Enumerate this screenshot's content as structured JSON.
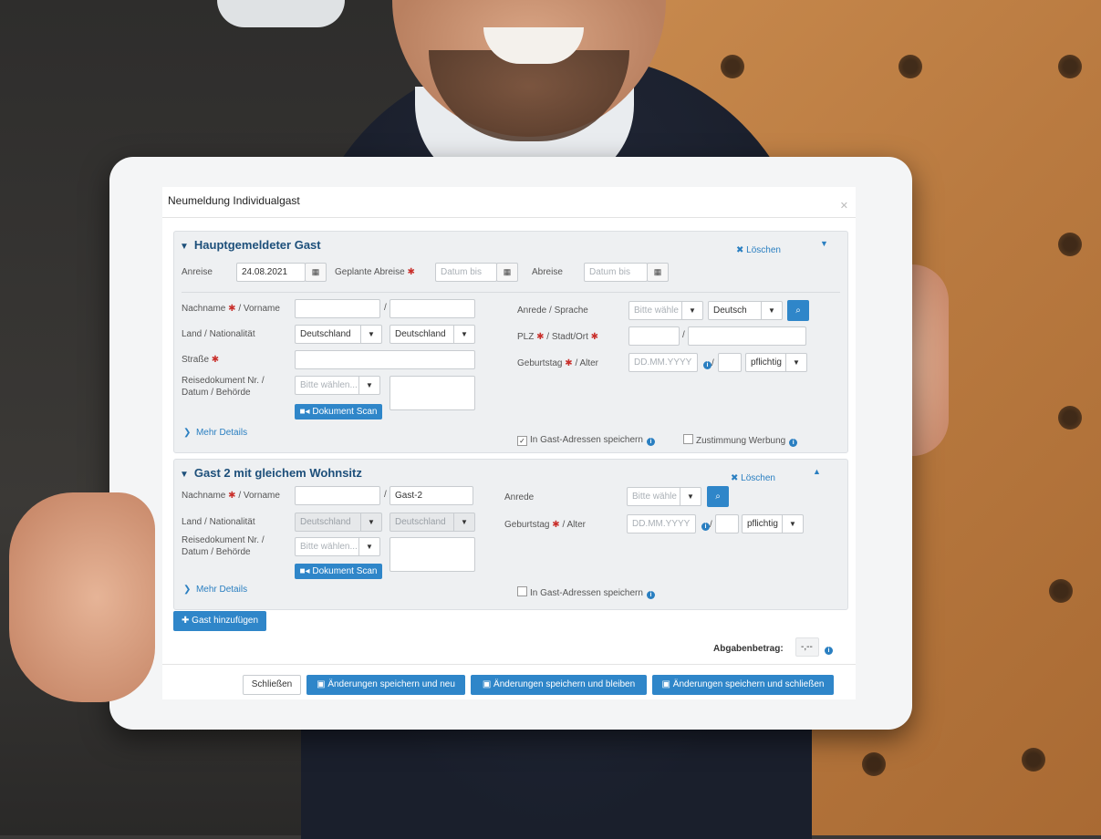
{
  "modal": {
    "title": "Neumeldung Individualgast",
    "close_icon": "close-icon"
  },
  "guest1": {
    "heading": "Hauptgemeldeter Gast",
    "delete_label": "Löschen",
    "arrival_label": "Anreise",
    "arrival_value": "24.08.2021",
    "planned_departure_label": "Geplante Abreise",
    "planned_departure_placeholder": "Datum bis",
    "departure_label": "Abreise",
    "departure_placeholder": "Datum bis",
    "name_label": "Nachname",
    "firstname_label": "/ Vorname",
    "country_label": "Land / Nationalität",
    "country_value": "Deutschland",
    "nationality_value": "Deutschland",
    "street_label": "Straße",
    "doc_label_1": "Reisedokument Nr. /",
    "doc_label_2": "Datum / Behörde",
    "doc_select_placeholder": "Bitte wählen...",
    "scan_button": "Dokument Scan",
    "salutation_label": "Anrede / Sprache",
    "salutation_placeholder": "Bitte wähle",
    "language_value": "Deutsch",
    "zip_label": "PLZ",
    "city_label": "/ Stadt/Ort",
    "birthday_label": "Geburtstag",
    "age_label": "/ Alter",
    "birthday_placeholder": "DD.MM.YYYY",
    "tax_value": "pflichtig",
    "more_details": "Mehr Details",
    "save_address_label": "In Gast-Adressen speichern",
    "save_address_checked": true,
    "consent_label": "Zustimmung Werbung"
  },
  "guest2": {
    "heading": "Gast 2 mit gleichem Wohnsitz",
    "delete_label": "Löschen",
    "name_label": "Nachname",
    "firstname_label": "/ Vorname",
    "firstname_value": "Gast-2",
    "country_label": "Land / Nationalität",
    "country_value": "Deutschland",
    "nationality_value": "Deutschland",
    "doc_label_1": "Reisedokument Nr. /",
    "doc_label_2": "Datum / Behörde",
    "doc_select_placeholder": "Bitte wählen...",
    "scan_button": "Dokument Scan",
    "salutation_label": "Anrede",
    "salutation_placeholder": "Bitte wähle",
    "birthday_label": "Geburtstag",
    "age_label": "/ Alter",
    "birthday_placeholder": "DD.MM.YYYY",
    "tax_value": "pflichtig",
    "more_details": "Mehr Details",
    "save_address_label": "In Gast-Adressen speichern",
    "save_address_checked": false
  },
  "add_guest_button": "Gast hinzufügen",
  "levy": {
    "label": "Abgabenbetrag:",
    "value": "-,--"
  },
  "footer": {
    "close_button": "Schließen",
    "save_new_button": "Änderungen speichern und neu",
    "save_stay_button": "Änderungen speichern und bleiben",
    "save_close_button": "Änderungen speichern und schließen"
  },
  "colors": {
    "primary": "#2f86c9",
    "heading": "#1d4f7a",
    "required": "#c9302c"
  }
}
